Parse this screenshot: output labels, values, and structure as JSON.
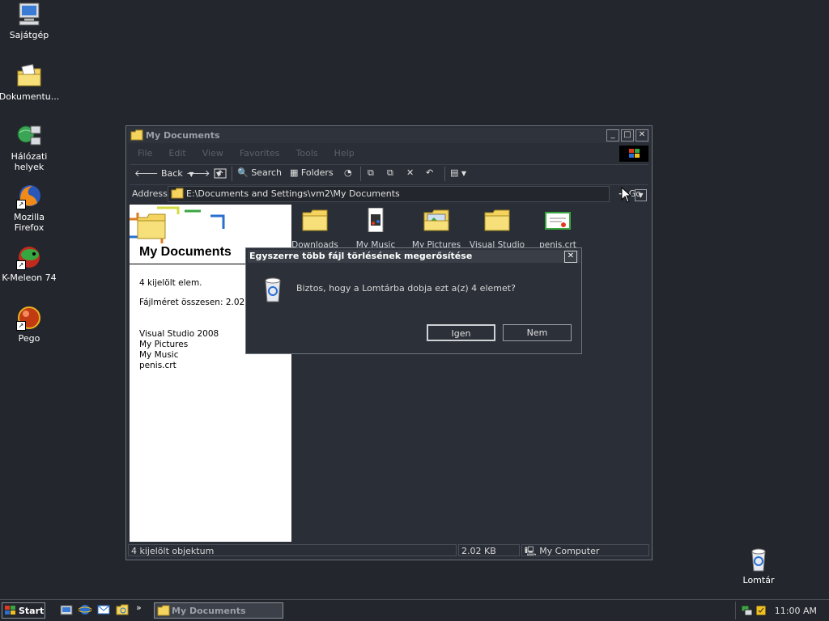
{
  "desktop": {
    "icons": [
      {
        "label": "Sajátgép"
      },
      {
        "label": "Dokumentu..."
      },
      {
        "label": "Hálózati helyek"
      },
      {
        "label": "Mozilla Firefox"
      },
      {
        "label": "K-Meleon 74"
      },
      {
        "label": "Pego"
      }
    ],
    "recycle_label": "Lomtár"
  },
  "window": {
    "title": "My Documents",
    "menu": [
      "File",
      "Edit",
      "View",
      "Favorites",
      "Tools",
      "Help"
    ],
    "toolbar": {
      "back": "Back",
      "search": "Search",
      "folders": "Folders"
    },
    "address": {
      "label": "Address",
      "value": "E:\\Documents and Settings\\vm2\\My Documents",
      "go": "Go"
    },
    "left_pane": {
      "title": "My Documents",
      "selected_count": "4 kijelölt elem.",
      "size_total": "Fájlméret összesen: 2.02 K",
      "selected_items": [
        "Visual Studio 2008",
        "My Pictures",
        "My Music",
        "penis.crt"
      ]
    },
    "files": [
      {
        "label": "Downloads",
        "icon": "folder-icon"
      },
      {
        "label": "My Music",
        "icon": "music-folder-icon"
      },
      {
        "label": "My Pictures",
        "icon": "pictures-folder-icon"
      },
      {
        "label": "Visual Studio",
        "icon": "folder-icon"
      },
      {
        "label": "penis.crt",
        "icon": "certificate-icon"
      }
    ],
    "status": {
      "objects": "4 kijelölt objektum",
      "size": "2.02 KB",
      "zone": "My Computer"
    }
  },
  "dialog": {
    "title": "Egyszerre több fájl törlésének megerősítése",
    "message": "Biztos, hogy a Lomtárba dobja ezt a(z) 4 elemet?",
    "yes": "Igen",
    "no": "Nem"
  },
  "taskbar": {
    "start": "Start",
    "chevron": "»",
    "task": "My Documents",
    "clock": "11:00 AM"
  }
}
